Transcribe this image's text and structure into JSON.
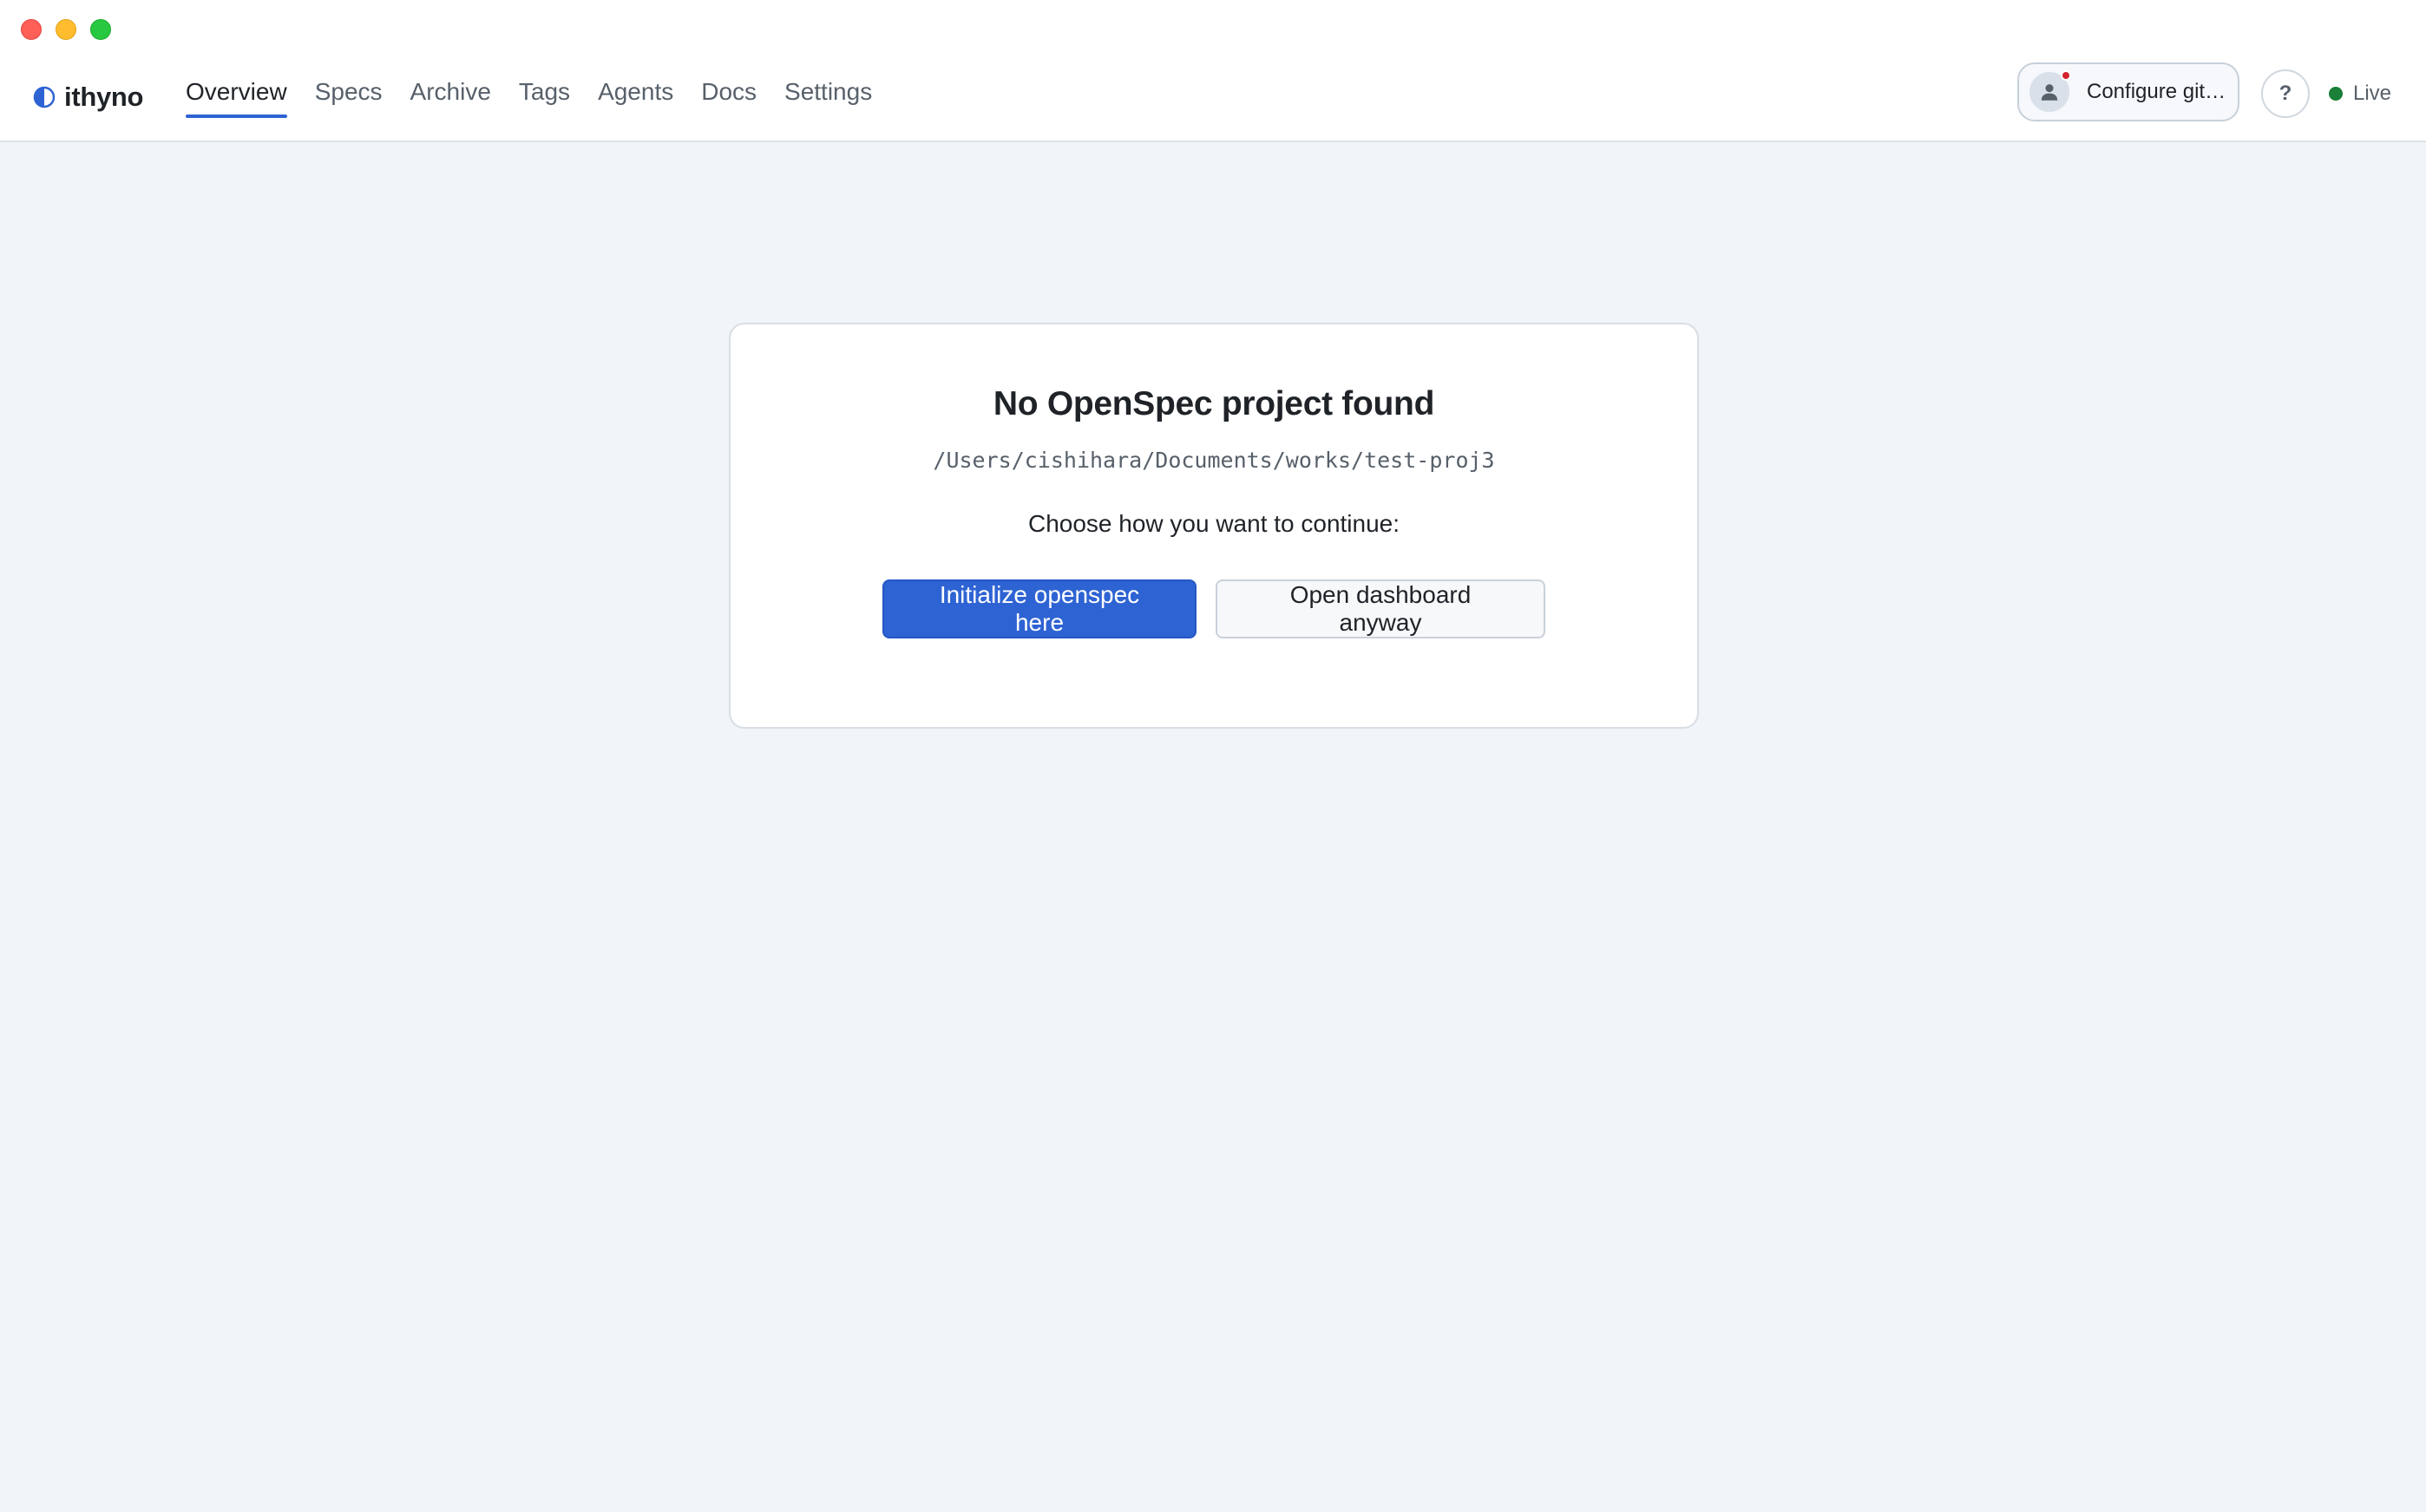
{
  "window": {
    "controls": [
      "close",
      "minimize",
      "maximize"
    ]
  },
  "header": {
    "brand": {
      "icon": "half-circle-logo-icon",
      "name": "ithyno",
      "accent": "#2e63d3"
    },
    "nav": [
      {
        "label": "Overview",
        "active": true
      },
      {
        "label": "Specs",
        "active": false
      },
      {
        "label": "Archive",
        "active": false
      },
      {
        "label": "Tags",
        "active": false
      },
      {
        "label": "Agents",
        "active": false
      },
      {
        "label": "Docs",
        "active": false
      },
      {
        "label": "Settings",
        "active": false
      }
    ],
    "git_button": {
      "icon": "user-icon",
      "label": "Configure git…",
      "alert_color": "#d1242f"
    },
    "help_label": "?",
    "status": {
      "label": "Live",
      "color": "#1a7f37"
    }
  },
  "card": {
    "title": "No OpenSpec project found",
    "path": "/Users/cishihara/Documents/works/test-proj3",
    "prompt": "Choose how you want to continue:",
    "primary_label": "Initialize openspec here",
    "secondary_label": "Open dashboard anyway"
  }
}
